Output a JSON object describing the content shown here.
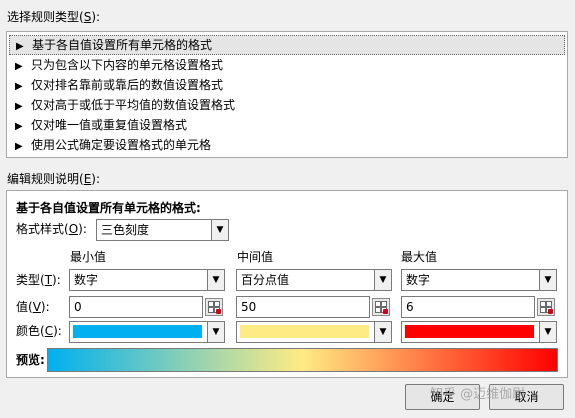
{
  "select_rule_type": {
    "label": "选择规则类型(",
    "key": "S",
    "suffix": "):"
  },
  "rule_types": [
    "基于各自值设置所有单元格的格式",
    "只为包含以下内容的单元格设置格式",
    "仅对排名靠前或靠后的数值设置格式",
    "仅对高于或低于平均值的数值设置格式",
    "仅对唯一值或重复值设置格式",
    "使用公式确定要设置格式的单元格"
  ],
  "edit_rule": {
    "label": "编辑规则说明(",
    "key": "E",
    "suffix": "):"
  },
  "desc_heading": "基于各自值设置所有单元格的格式:",
  "format_style": {
    "label": "格式样式(",
    "key": "O",
    "suffix": "):",
    "value": "三色刻度"
  },
  "columns": [
    {
      "header": "最小值",
      "type": "数字",
      "value": "0",
      "color": "#00b0f0"
    },
    {
      "header": "中间值",
      "type": "百分点值",
      "value": "50",
      "color": "#ffeb84"
    },
    {
      "header": "最大值",
      "type": "数字",
      "value": "6",
      "color": "#ff0000"
    }
  ],
  "row_labels": {
    "type": {
      "label": "类型(",
      "key": "T",
      "suffix": "):"
    },
    "value": {
      "label": "值(",
      "key": "V",
      "suffix": "):"
    },
    "color": {
      "label": "颜色(",
      "key": "C",
      "suffix": "):"
    }
  },
  "preview_label": "预览:",
  "buttons": {
    "ok": "确定",
    "cancel": "取消"
  },
  "watermark": "知乎 @迈维伽尉"
}
